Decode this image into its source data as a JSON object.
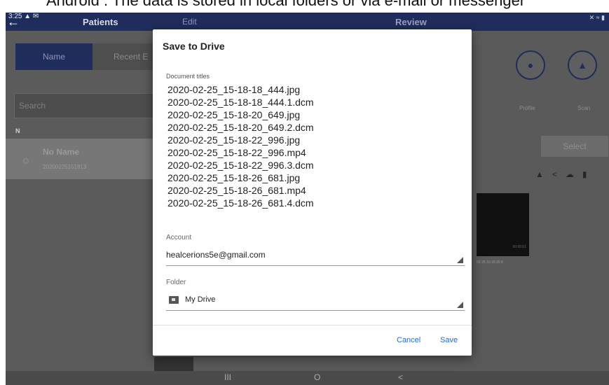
{
  "caption": "Android : The data is stored in local folders or via e-mail or messenger",
  "statusbar": {
    "time": "3:25 ▲ ✉",
    "icons": "✕ ≈ ▮"
  },
  "topbar": {
    "back_icon": "←",
    "tabs": [
      "Patients",
      "Edit",
      "Review"
    ]
  },
  "patients": {
    "segments": [
      "Name",
      "Recent E"
    ],
    "search_placeholder": "Search",
    "group_letter": "N",
    "rows": [
      {
        "name": "No Name",
        "id": "20200225151813"
      }
    ]
  },
  "review": {
    "profile_label": "Profile",
    "scan_label": "Scan",
    "select_label": "Select",
    "thumb_timestamp": "00:00:01",
    "thumb_date": "02-25 15:18:26 8"
  },
  "dialog": {
    "title": "Save to Drive",
    "document_titles_label": "Document titles",
    "documents": [
      "2020-02-25_15-18-18_444.jpg",
      "2020-02-25_15-18-18_444.1.dcm",
      "2020-02-25_15-18-20_649.jpg",
      "2020-02-25_15-18-20_649.2.dcm",
      "2020-02-25_15-18-22_996.jpg",
      "2020-02-25_15-18-22_996.mp4",
      "2020-02-25_15-18-22_996.3.dcm",
      "2020-02-25_15-18-26_681.jpg",
      "2020-02-25_15-18-26_681.mp4",
      "2020-02-25_15-18-26_681.4.dcm"
    ],
    "account_label": "Account",
    "account_value": "healcerions5e@gmail.com",
    "folder_label": "Folder",
    "folder_value": "My Drive",
    "cancel_label": "Cancel",
    "save_label": "Save"
  },
  "navbar": {
    "recents": "III",
    "home": "O",
    "back": "<"
  },
  "colors": {
    "primary_navy": "#1f2d5c",
    "link_blue": "#1a6ce8",
    "scrim_gray": "#5a5a5a"
  }
}
